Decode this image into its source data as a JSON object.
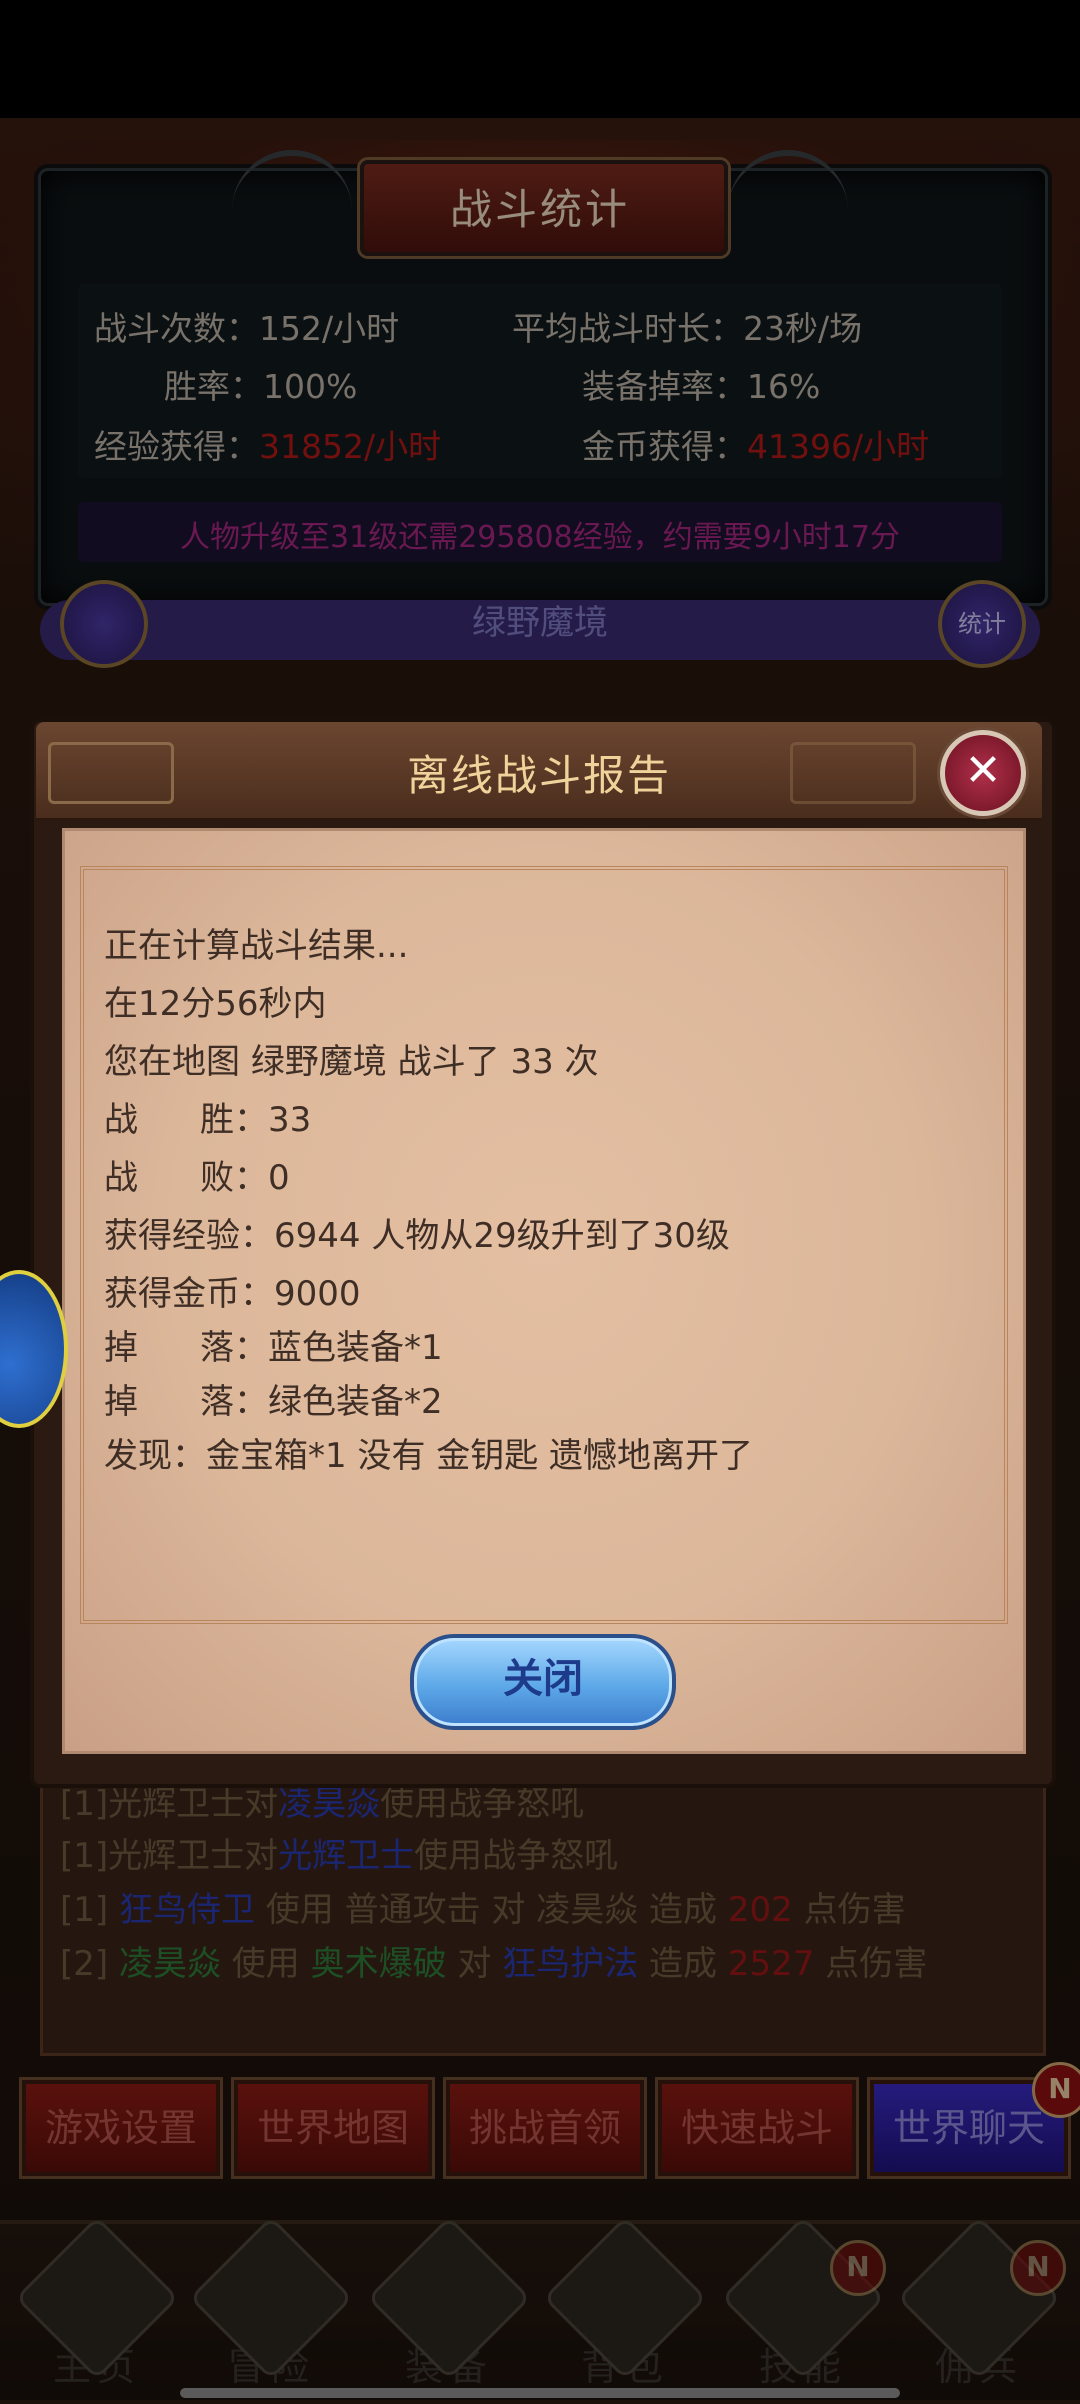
{
  "stats": {
    "title": "战斗统计",
    "battles_label": "战斗次数：",
    "battles_value": "152/小时",
    "avg_label": "平均战斗时长：",
    "avg_value": "23秒/场",
    "win_label": "胜率：",
    "win_value": "100%",
    "drop_label": "装备掉率：",
    "drop_value": "16%",
    "exp_label": "经验获得：",
    "exp_value": "31852/小时",
    "gold_label": "金币获得：",
    "gold_value": "41396/小时",
    "level_note": "人物升级至31级还需295808经验，约需要9小时17分"
  },
  "behind": {
    "map_name": "绿野魔境",
    "stats_button": "统计"
  },
  "modal": {
    "title": "离线战斗报告",
    "close_icon": "close-x",
    "lines": {
      "calculating": "正在计算战斗结果...",
      "duration": "在12分56秒内",
      "map_prefix": "您在地图",
      "map_name": "绿野魔境",
      "map_middle": "战斗了",
      "battle_count": "33",
      "map_suffix": "次",
      "win_label": "战",
      "win_label2": "胜：",
      "win_value": "33",
      "lose_label": "战",
      "lose_label2": "败：",
      "lose_value": "0",
      "exp_label": "获得经验：",
      "exp_value": "6944",
      "level_up": "人物从29级升到了30级",
      "gold_label": "获得金币：",
      "gold_value": "9000",
      "drop_label": "掉",
      "drop_label2": "落：",
      "drop1": "蓝色装备*1",
      "drop2": "绿色装备*2",
      "found": "发现：金宝箱*1 没有 金钥匙 遗憾地离开了"
    },
    "close_button": "关闭"
  },
  "log": {
    "line1_prefix": "[1]光辉卫士对",
    "line1_target": "凌昊焱",
    "line1_suffix": "使用战争怒吼",
    "line2_prefix": "[1]光辉卫士对",
    "line2_target": "光辉卫士",
    "line2_suffix": "使用战争怒吼",
    "line3_num": "[1]",
    "line3_actor": "狂鸟侍卫",
    "line3_use": "使用",
    "line3_skill": "普通攻击",
    "line3_to": "对",
    "line3_target": "凌昊焱",
    "line3_deal": "造成",
    "line3_dmg": "202",
    "line3_end": "点伤害",
    "line4_num": "[2]",
    "line4_actor": "凌昊焱",
    "line4_use": "使用",
    "line4_skill": "奥术爆破",
    "line4_to": "对",
    "line4_target": "狂鸟护法",
    "line4_deal": "造成",
    "line4_dmg": "2527",
    "line4_end": "点伤害"
  },
  "actions": {
    "settings": "游戏设置",
    "world_map": "世界地图",
    "challenge": "挑战首领",
    "quick_battle": "快速战斗",
    "world_chat": "世界聊天",
    "badge": "N"
  },
  "nav": {
    "home": "主页",
    "adventure": "冒险",
    "equipment": "装备",
    "bag": "背包",
    "skills": "技能",
    "mercenary": "佣兵",
    "badge": "N"
  },
  "colors": {
    "red_value": "#b01818",
    "purple_note": "#a3267e",
    "modal_title": "#f0d39a",
    "close_button_blue": "#5da8e8"
  }
}
